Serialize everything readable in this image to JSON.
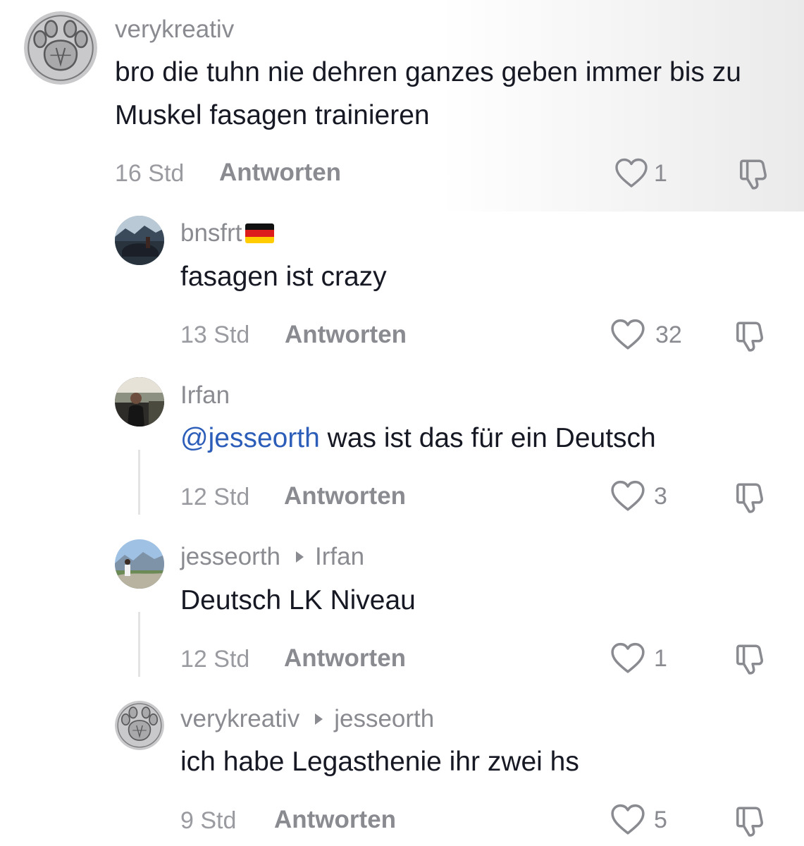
{
  "comments": [
    {
      "username": "verykreativ",
      "text": "bro die tuhn nie dehren ganzes geben immer bis zu Muskel fasagen trainieren",
      "time": "16 Std",
      "reply_label": "Antworten",
      "likes": "1",
      "avatar_icon": "paw-logo-icon"
    },
    {
      "username": "bnsfrt",
      "flag_icon": "german-flag-icon",
      "text": "fasagen ist crazy",
      "time": "13 Std",
      "reply_label": "Antworten",
      "likes": "32",
      "avatar_icon": "car-photo-avatar"
    },
    {
      "username": "Irfan",
      "mention": "@jesseorth",
      "text": " was ist das für ein Deutsch",
      "time": "12 Std",
      "reply_label": "Antworten",
      "likes": "3",
      "avatar_icon": "person-photo-avatar"
    },
    {
      "username": "jesseorth",
      "reply_to": "Irfan",
      "text": "Deutsch LK Niveau",
      "time": "12 Std",
      "reply_label": "Antworten",
      "likes": "1",
      "avatar_icon": "mountain-photo-avatar"
    },
    {
      "username": "verykreativ",
      "reply_to": "jesseorth",
      "text": "ich habe Legasthenie ihr zwei hs",
      "time": "9 Std",
      "reply_label": "Antworten",
      "likes": "5",
      "avatar_icon": "paw-logo-icon"
    }
  ],
  "colors": {
    "text": "#161823",
    "muted": "#8a8b91",
    "mention": "#2b5db9"
  }
}
